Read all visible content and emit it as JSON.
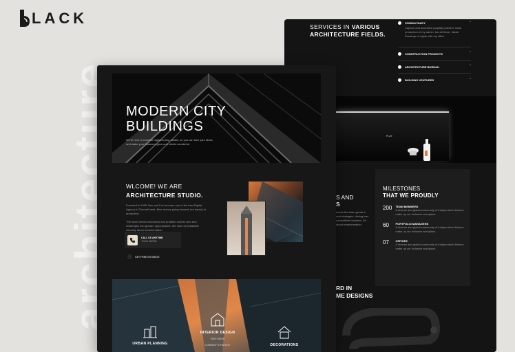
{
  "brand": {
    "logo_text": "LACK"
  },
  "watermark": "architecture",
  "hero": {
    "title_line1": "MODERN CITY",
    "title_line2": "BUILDINGS",
    "desc": "We're here to craft the digital-boring details, so you can lose your ideas and make your business grow and clients wonderful."
  },
  "about": {
    "heading_line1": "WLCOME! WE ARE",
    "heading_line2": "ARCHITECTURE STUDIO.",
    "para1": "Founded in 1995, Ben and Fox become one of the best Digital Agency in ThemeForest. Blue money going forward, but deploy to production.",
    "para2": "The world needs innovators and problem solvers who turn challenges into greater opportunities. We have an insatiable curiosity about transformation.",
    "call_label": "CALL US ANYTIME",
    "call_number": "+0123 487006",
    "estimate_link": "GET FREE ESTIMATE"
  },
  "services": {
    "heading_line1": "SERVICES IN",
    "heading_bold1": "VARIOUS",
    "heading_line2": "ARCHITECTURE FIELDS.",
    "items": [
      {
        "title": "CONSULTANCY",
        "desc": "Capture and accessed (capital) problem. Ideal production of my admin, but all these. Ideas! Drawings of rights with my office."
      },
      {
        "title": "CONSTRUCTION PROJECTS"
      },
      {
        "title": "ARCHITECTURE BUREAU"
      },
      {
        "title": "BUILDING VENTURES"
      }
    ]
  },
  "play_label": "PLAY",
  "partial_left": {
    "line1": "S AND",
    "line2": "S",
    "body": "needs the team grows a real strategies, driving less competitive business. All about transformation."
  },
  "milestones": {
    "heading_line1": "MILESTONES",
    "heading_line2": "THAT WE PROUDLY",
    "items": [
      {
        "value": "200",
        "title": "TEAM MEMBERS",
        "desc": "A diverse and global community of independent thinkers make up our inclusive workplace."
      },
      {
        "value": "60",
        "title": "PORTFOLIO MANAGERS",
        "desc": "A diverse and global community of independent thinkers make up our inclusive workplace."
      },
      {
        "value": "07",
        "title": "OFFICES",
        "desc": "A diverse and global community of independent thinkers make up our inclusive workplace."
      }
    ]
  },
  "partial_bottom": {
    "line1": "RD IN",
    "line2": "ME DESIGNS"
  },
  "features": [
    {
      "label": "URBAN PLANNING"
    },
    {
      "label": "INTERIOR DESIGN",
      "sub1": "OUR VISION",
      "sub2": "COMPANY STRATEGY"
    },
    {
      "label": "DECORATIONS"
    }
  ],
  "colors": {
    "accent": "#e07a3c",
    "dark": "#141414",
    "bg": "#e4e2de"
  }
}
